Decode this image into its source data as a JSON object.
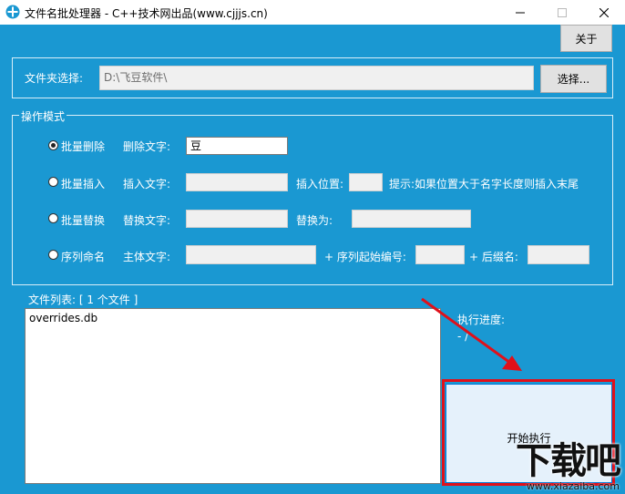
{
  "window": {
    "title": "文件名批处理器 - C++技术网出品(www.cjjjs.cn)",
    "accent": "#1a98d2"
  },
  "toolbar": {
    "about_label": "关于"
  },
  "folder": {
    "label": "文件夹选择:",
    "path": "D:\\飞豆软件\\",
    "choose_label": "选择..."
  },
  "modes": {
    "group_label": "操作模式",
    "selected": "batch_delete",
    "delete": {
      "radio_label": "批量删除",
      "text_label": "删除文字:",
      "text_value": "豆"
    },
    "insert": {
      "radio_label": "批量插入",
      "text_label": "插入文字:",
      "position_label": "插入位置:",
      "hint": "提示:如果位置大于名字长度则插入末尾"
    },
    "replace": {
      "radio_label": "批量替换",
      "text_label": "替换文字:",
      "replace_with_label": "替换为:"
    },
    "sequence": {
      "radio_label": "序列命名",
      "main_label": "主体文字:",
      "start_label": "+ 序列起始编号:",
      "suffix_label": "+ 后缀名:"
    }
  },
  "files": {
    "header": "文件列表: [ 1 个文件 ]",
    "items": [
      "overrides.db"
    ]
  },
  "progress": {
    "label": "执行进度:",
    "value": "- / -"
  },
  "run": {
    "label": "开始执行"
  },
  "watermark": {
    "brand": "下载吧",
    "url": "www.xiazaiba.com"
  }
}
